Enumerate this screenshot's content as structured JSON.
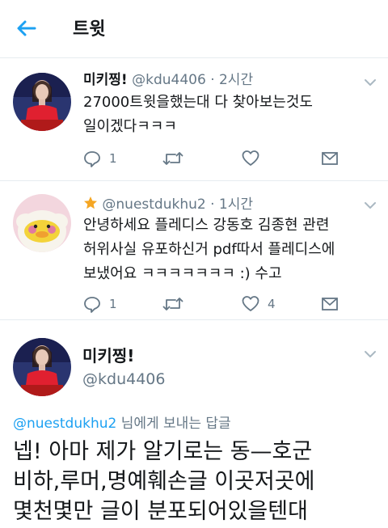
{
  "header": {
    "title": "트윗"
  },
  "tweets": [
    {
      "name": "미키찡!",
      "handle": "@kdu4406",
      "time": "· 2시간",
      "lines": [
        "27000트윗을했는대 다 찾아보는것도",
        "일이겠다ㅋㅋㅋ"
      ],
      "reply_count": "1",
      "retweet_count": "",
      "like_count": ""
    },
    {
      "name": "",
      "handle": "@nuestdukhu2",
      "time": "· 1시간",
      "lines": [
        "안녕하세요 플레디스 강동호 김종현 관련",
        "허위사실 유포하신거 pdf따서 플레디스에",
        "보냈어요 ㅋㅋㅋㅋㅋㅋㅋ :) 수고"
      ],
      "reply_count": "1",
      "retweet_count": "",
      "like_count": "4"
    }
  ],
  "main_tweet": {
    "name": "미키찡!",
    "handle": "@kdu4406",
    "reply_to": "@nuestdukhu2",
    "reply_suffix": " 님에게 보내는 답글",
    "lines": [
      "넵! 아마 제가 알기로는 동—호군",
      "비하,루머,명예훼손글 이곳저곳에",
      "몇천몇만 글이 분포되어있을텐대"
    ]
  },
  "icons": {
    "back": "arrow-left-icon",
    "caret": "chevron-down-icon",
    "reply": "reply-icon",
    "retweet": "retweet-icon",
    "like": "heart-icon",
    "dm": "envelope-icon",
    "star": "star-icon"
  },
  "colors": {
    "accent": "#1da1f2",
    "secondary_text": "#657786",
    "star": "#f5a623",
    "divider": "#e6ecf0"
  }
}
